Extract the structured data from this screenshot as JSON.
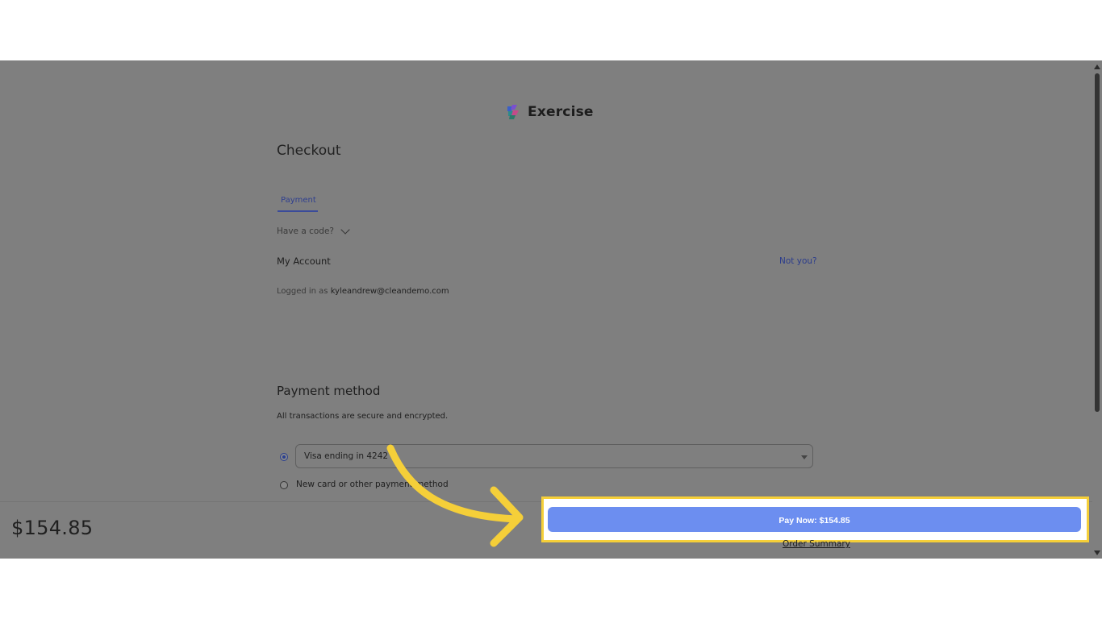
{
  "brand": {
    "name": "Exercise",
    "logo_icon": "stacked-layers-logo-icon"
  },
  "page": {
    "title": "Checkout"
  },
  "tabs": [
    {
      "label": "Payment",
      "active": true
    }
  ],
  "code": {
    "label": "Have a code?",
    "icon": "chevron-down-icon"
  },
  "account": {
    "title": "My Account",
    "not_you": "Not you?",
    "logged_in_prefix": "Logged in as",
    "email": "kyleandrew@cleandemo.com"
  },
  "payment": {
    "title": "Payment method",
    "subtitle": "All transactions are secure and encrypted.",
    "selected_card": "Visa ending in 4242",
    "new_option": "New card or other payment method"
  },
  "footer": {
    "total": "$154.85",
    "pay_button": "Pay Now: $154.85",
    "order_summary": "Order Summary"
  },
  "colors": {
    "overlay": "#7f7f7f",
    "pay_button": "#6c8ef0",
    "highlight": "#f5cf39",
    "link": "#2b3c8c"
  }
}
